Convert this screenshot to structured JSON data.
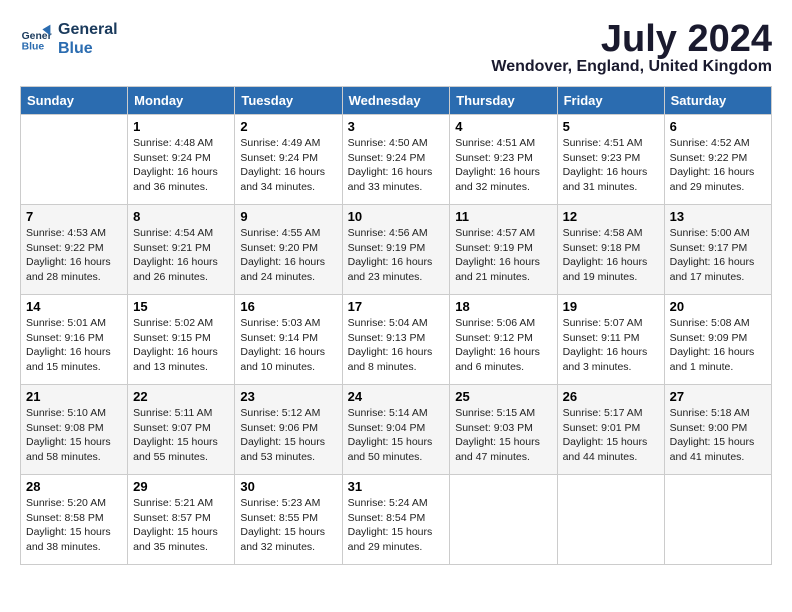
{
  "logo": {
    "line1": "General",
    "line2": "Blue"
  },
  "title": "July 2024",
  "location": "Wendover, England, United Kingdom",
  "days_of_week": [
    "Sunday",
    "Monday",
    "Tuesday",
    "Wednesday",
    "Thursday",
    "Friday",
    "Saturday"
  ],
  "weeks": [
    [
      {
        "num": "",
        "info": ""
      },
      {
        "num": "1",
        "info": "Sunrise: 4:48 AM\nSunset: 9:24 PM\nDaylight: 16 hours\nand 36 minutes."
      },
      {
        "num": "2",
        "info": "Sunrise: 4:49 AM\nSunset: 9:24 PM\nDaylight: 16 hours\nand 34 minutes."
      },
      {
        "num": "3",
        "info": "Sunrise: 4:50 AM\nSunset: 9:24 PM\nDaylight: 16 hours\nand 33 minutes."
      },
      {
        "num": "4",
        "info": "Sunrise: 4:51 AM\nSunset: 9:23 PM\nDaylight: 16 hours\nand 32 minutes."
      },
      {
        "num": "5",
        "info": "Sunrise: 4:51 AM\nSunset: 9:23 PM\nDaylight: 16 hours\nand 31 minutes."
      },
      {
        "num": "6",
        "info": "Sunrise: 4:52 AM\nSunset: 9:22 PM\nDaylight: 16 hours\nand 29 minutes."
      }
    ],
    [
      {
        "num": "7",
        "info": "Sunrise: 4:53 AM\nSunset: 9:22 PM\nDaylight: 16 hours\nand 28 minutes."
      },
      {
        "num": "8",
        "info": "Sunrise: 4:54 AM\nSunset: 9:21 PM\nDaylight: 16 hours\nand 26 minutes."
      },
      {
        "num": "9",
        "info": "Sunrise: 4:55 AM\nSunset: 9:20 PM\nDaylight: 16 hours\nand 24 minutes."
      },
      {
        "num": "10",
        "info": "Sunrise: 4:56 AM\nSunset: 9:19 PM\nDaylight: 16 hours\nand 23 minutes."
      },
      {
        "num": "11",
        "info": "Sunrise: 4:57 AM\nSunset: 9:19 PM\nDaylight: 16 hours\nand 21 minutes."
      },
      {
        "num": "12",
        "info": "Sunrise: 4:58 AM\nSunset: 9:18 PM\nDaylight: 16 hours\nand 19 minutes."
      },
      {
        "num": "13",
        "info": "Sunrise: 5:00 AM\nSunset: 9:17 PM\nDaylight: 16 hours\nand 17 minutes."
      }
    ],
    [
      {
        "num": "14",
        "info": "Sunrise: 5:01 AM\nSunset: 9:16 PM\nDaylight: 16 hours\nand 15 minutes."
      },
      {
        "num": "15",
        "info": "Sunrise: 5:02 AM\nSunset: 9:15 PM\nDaylight: 16 hours\nand 13 minutes."
      },
      {
        "num": "16",
        "info": "Sunrise: 5:03 AM\nSunset: 9:14 PM\nDaylight: 16 hours\nand 10 minutes."
      },
      {
        "num": "17",
        "info": "Sunrise: 5:04 AM\nSunset: 9:13 PM\nDaylight: 16 hours\nand 8 minutes."
      },
      {
        "num": "18",
        "info": "Sunrise: 5:06 AM\nSunset: 9:12 PM\nDaylight: 16 hours\nand 6 minutes."
      },
      {
        "num": "19",
        "info": "Sunrise: 5:07 AM\nSunset: 9:11 PM\nDaylight: 16 hours\nand 3 minutes."
      },
      {
        "num": "20",
        "info": "Sunrise: 5:08 AM\nSunset: 9:09 PM\nDaylight: 16 hours\nand 1 minute."
      }
    ],
    [
      {
        "num": "21",
        "info": "Sunrise: 5:10 AM\nSunset: 9:08 PM\nDaylight: 15 hours\nand 58 minutes."
      },
      {
        "num": "22",
        "info": "Sunrise: 5:11 AM\nSunset: 9:07 PM\nDaylight: 15 hours\nand 55 minutes."
      },
      {
        "num": "23",
        "info": "Sunrise: 5:12 AM\nSunset: 9:06 PM\nDaylight: 15 hours\nand 53 minutes."
      },
      {
        "num": "24",
        "info": "Sunrise: 5:14 AM\nSunset: 9:04 PM\nDaylight: 15 hours\nand 50 minutes."
      },
      {
        "num": "25",
        "info": "Sunrise: 5:15 AM\nSunset: 9:03 PM\nDaylight: 15 hours\nand 47 minutes."
      },
      {
        "num": "26",
        "info": "Sunrise: 5:17 AM\nSunset: 9:01 PM\nDaylight: 15 hours\nand 44 minutes."
      },
      {
        "num": "27",
        "info": "Sunrise: 5:18 AM\nSunset: 9:00 PM\nDaylight: 15 hours\nand 41 minutes."
      }
    ],
    [
      {
        "num": "28",
        "info": "Sunrise: 5:20 AM\nSunset: 8:58 PM\nDaylight: 15 hours\nand 38 minutes."
      },
      {
        "num": "29",
        "info": "Sunrise: 5:21 AM\nSunset: 8:57 PM\nDaylight: 15 hours\nand 35 minutes."
      },
      {
        "num": "30",
        "info": "Sunrise: 5:23 AM\nSunset: 8:55 PM\nDaylight: 15 hours\nand 32 minutes."
      },
      {
        "num": "31",
        "info": "Sunrise: 5:24 AM\nSunset: 8:54 PM\nDaylight: 15 hours\nand 29 minutes."
      },
      {
        "num": "",
        "info": ""
      },
      {
        "num": "",
        "info": ""
      },
      {
        "num": "",
        "info": ""
      }
    ]
  ]
}
